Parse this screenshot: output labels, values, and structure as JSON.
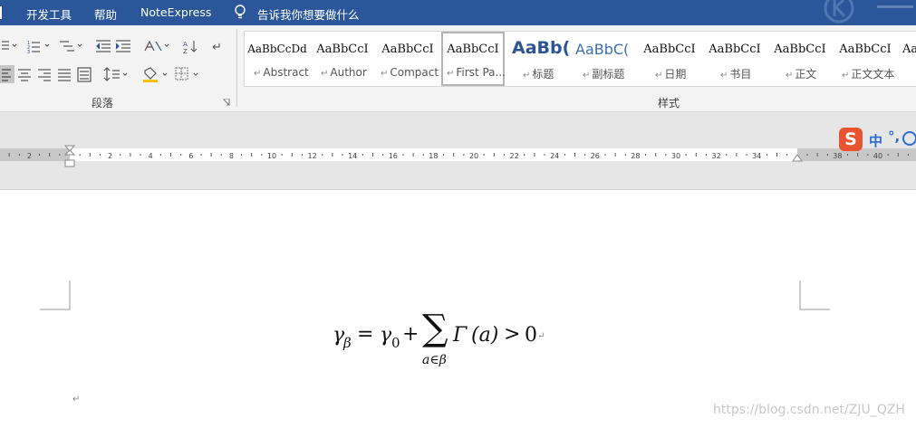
{
  "menubar": {
    "tabs": [
      "开发工具",
      "帮助",
      "NoteExpress"
    ],
    "tell_me": "告诉我你想要做什么"
  },
  "ribbon": {
    "paragraph_group_label": "段落",
    "styles_group_label": "样式",
    "styles": [
      {
        "sample": "AaBbCcDd",
        "name": "Abstract"
      },
      {
        "sample": "AaBbCcI",
        "name": "Author"
      },
      {
        "sample": "AaBbCcI",
        "name": "Compact"
      },
      {
        "sample": "AaBbCcI",
        "name": "First Pa..."
      },
      {
        "sample": "AaBb(",
        "name": "标题"
      },
      {
        "sample": "AaBbC(",
        "name": "副标题"
      },
      {
        "sample": "AaBbCcI",
        "name": "日期"
      },
      {
        "sample": "AaBbCcI",
        "name": "书目"
      },
      {
        "sample": "AaBbCcI",
        "name": "正文"
      },
      {
        "sample": "AaBbCcI",
        "name": "正文文本"
      },
      {
        "sample": "Aa",
        "name": ""
      }
    ]
  },
  "ruler": {
    "left_numbers": [
      "2"
    ],
    "numbers": [
      "2",
      "4",
      "6",
      "8",
      "10",
      "12",
      "14",
      "16",
      "18",
      "20",
      "22",
      "24",
      "26",
      "28",
      "30",
      "32",
      "34"
    ],
    "right_numbers": [
      "38",
      "40",
      "4"
    ]
  },
  "ime": {
    "logo": "S",
    "lang": "中",
    "punct": "°,"
  },
  "document": {
    "equation": {
      "gamma": "γ",
      "sub_beta": "β",
      "equals": "=",
      "sub_zero": "0",
      "plus": "+",
      "sum": "∑",
      "sum_sub": "a∈β",
      "Gamma": "Γ",
      "arg": "(a)",
      "gt": ">",
      "zero": "0"
    },
    "paragraph_mark": "↵",
    "watermark": "https://blog.csdn.net/ZJU_QZH"
  }
}
